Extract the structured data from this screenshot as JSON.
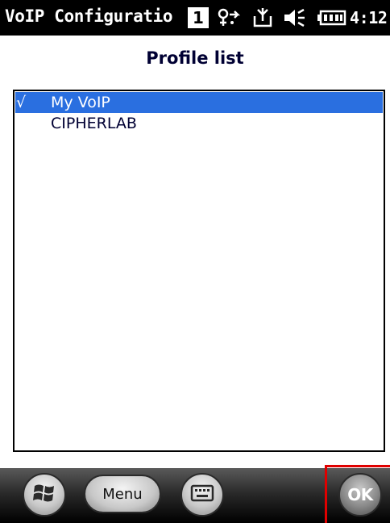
{
  "titlebar": {
    "title": "VoIP Configuratio",
    "badge": "1",
    "time": "4:12",
    "icons": [
      "connectivity-icon",
      "sync-icon",
      "volume-icon",
      "battery-icon"
    ]
  },
  "page": {
    "title": "Profile list"
  },
  "profiles": [
    {
      "check": "√",
      "label": "My VoIP",
      "selected": true
    },
    {
      "check": "",
      "label": "CIPHERLAB",
      "selected": false
    }
  ],
  "softkeys": {
    "start_icon": "windows-start-icon",
    "menu_label": "Menu",
    "keyboard_icon": "keyboard-icon",
    "ok_label": "OK"
  },
  "colors": {
    "selection": "#2a6fe0",
    "highlight_box": "#e00000",
    "titlebar": "#000000"
  }
}
